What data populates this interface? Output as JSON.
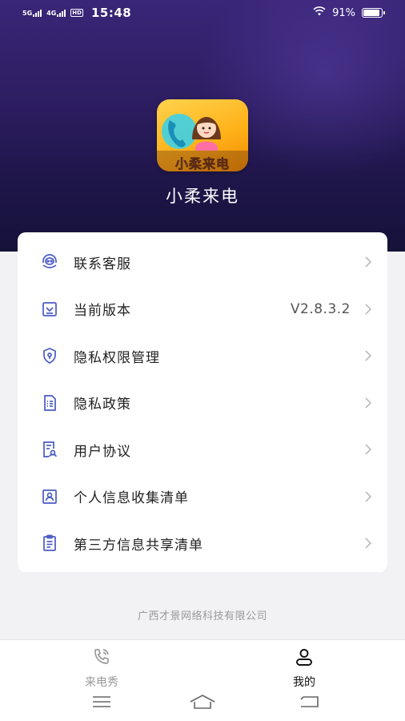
{
  "status_bar": {
    "net1": "5G",
    "net2": "4G",
    "hd": "HD",
    "time": "15:48",
    "battery_text": "91%",
    "battery_level": 0.91
  },
  "app": {
    "logo_text": "小柔来电",
    "name": "小柔来电"
  },
  "menu": {
    "items": [
      {
        "icon": "headset-icon",
        "label": "联系客服",
        "value": ""
      },
      {
        "icon": "version-icon",
        "label": "当前版本",
        "value": "V2.8.3.2"
      },
      {
        "icon": "shield-icon",
        "label": "隐私权限管理",
        "value": ""
      },
      {
        "icon": "document-list-icon",
        "label": "隐私政策",
        "value": ""
      },
      {
        "icon": "agreement-icon",
        "label": "用户协议",
        "value": ""
      },
      {
        "icon": "person-card-icon",
        "label": "个人信息收集清单",
        "value": ""
      },
      {
        "icon": "clipboard-icon",
        "label": "第三方信息共享清单",
        "value": ""
      }
    ]
  },
  "footer": {
    "company": "广西才景网络科技有限公司"
  },
  "tabs": {
    "call_show": "来电秀",
    "mine": "我的"
  },
  "colors": {
    "accent": "#4a5bc4",
    "hero_top": "#3a2678",
    "hero_bottom": "#15123a"
  }
}
